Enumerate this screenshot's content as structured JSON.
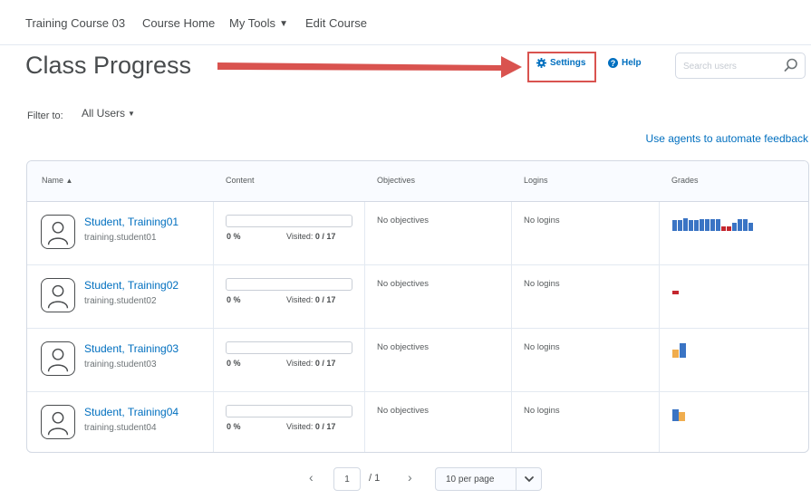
{
  "nav": {
    "items": [
      "Training Course 03",
      "Course Home",
      "My Tools",
      "Edit Course"
    ]
  },
  "page": {
    "title": "Class Progress"
  },
  "toolbar": {
    "settings_label": "Settings",
    "help_label": "Help",
    "search_placeholder": "Search users"
  },
  "filter": {
    "label": "Filter to:",
    "value": "All Users"
  },
  "agents_link": "Use agents to automate feedback",
  "table": {
    "headers": [
      "Name",
      "Content",
      "Objectives",
      "Logins",
      "Grades"
    ],
    "rows": [
      {
        "name": "Student, Training01",
        "username": "training.student01",
        "content_pct": "0 %",
        "visited_label": "Visited:",
        "visited_value": "0 / 17",
        "objectives": "No objectives",
        "logins": "No logins"
      },
      {
        "name": "Student, Training02",
        "username": "training.student02",
        "content_pct": "0 %",
        "visited_label": "Visited:",
        "visited_value": "0 / 17",
        "objectives": "No objectives",
        "logins": "No logins"
      },
      {
        "name": "Student, Training03",
        "username": "training.student03",
        "content_pct": "0 %",
        "visited_label": "Visited:",
        "visited_value": "0 / 17",
        "objectives": "No objectives",
        "logins": "No logins"
      },
      {
        "name": "Student, Training04",
        "username": "training.student04",
        "content_pct": "0 %",
        "visited_label": "Visited:",
        "visited_value": "0 / 17",
        "objectives": "No objectives",
        "logins": "No logins"
      }
    ]
  },
  "grade_colors": {
    "blue": "#3a74c4",
    "red": "#c4262e",
    "orange": "#f0ad4e"
  },
  "pagination": {
    "current_page": "1",
    "total": "/ 1",
    "per_page": "10 per page"
  },
  "colors": {
    "link": "#006fbf",
    "highlight_box": "#d9534f",
    "arrow": "#d9534f"
  }
}
